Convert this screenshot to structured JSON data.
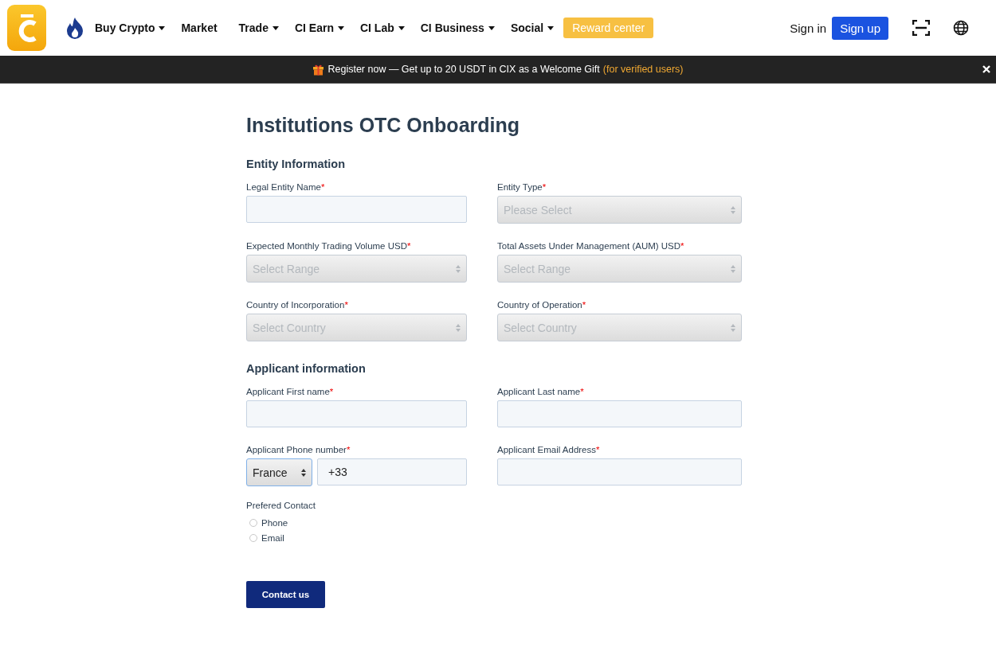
{
  "nav": {
    "items": [
      {
        "label": "Buy Crypto",
        "dropdown": true
      },
      {
        "label": "Market",
        "dropdown": false
      },
      {
        "label": "Trade",
        "dropdown": true
      },
      {
        "label": "CI Earn",
        "dropdown": true
      },
      {
        "label": "CI Lab",
        "dropdown": true
      },
      {
        "label": "CI Business",
        "dropdown": true
      },
      {
        "label": "Social",
        "dropdown": true
      }
    ],
    "reward": "Reward center",
    "sign_in": "Sign in",
    "sign_up": "Sign up"
  },
  "banner": {
    "text": "Register now — Get up to 20 USDT in CIX as a Welcome Gift",
    "highlight": "(for verified users)"
  },
  "title": "Institutions OTC Onboarding",
  "sections": [
    {
      "heading": "Entity Information",
      "fields": [
        {
          "label": "Legal Entity Name",
          "required_mark": "*",
          "kind": "text"
        },
        {
          "label": "Entity Type",
          "required_mark": "*",
          "kind": "select",
          "placeholder": "Please Select"
        },
        {
          "label": "Expected Monthly Trading Volume USD",
          "required_mark": "*",
          "kind": "select",
          "placeholder": "Select Range"
        },
        {
          "label": "Total Assets Under Management (AUM) USD",
          "required_mark": "*",
          "kind": "select",
          "placeholder": "Select Range"
        },
        {
          "label": "Country of Incorporation",
          "required_mark": "*",
          "kind": "select",
          "placeholder": "Select Country"
        },
        {
          "label": "Country of Operation",
          "required_mark": "*",
          "kind": "select",
          "placeholder": "Select Country"
        }
      ]
    },
    {
      "heading": "Applicant information",
      "fields": [
        {
          "label": "Applicant First name",
          "required_mark": "*",
          "kind": "text"
        },
        {
          "label": "Applicant Last name",
          "required_mark": "*",
          "kind": "text"
        },
        {
          "label": "Applicant Phone number",
          "required_mark": "*",
          "kind": "phone",
          "country": "France",
          "value": "+33"
        },
        {
          "label": "Applicant Email Address",
          "required_mark": "*",
          "kind": "text"
        }
      ]
    }
  ],
  "contact": {
    "label": "Prefered Contact",
    "options": [
      {
        "label": "Phone",
        "selected": false
      },
      {
        "label": "Email",
        "selected": false
      }
    ]
  },
  "submit": "Contact us"
}
